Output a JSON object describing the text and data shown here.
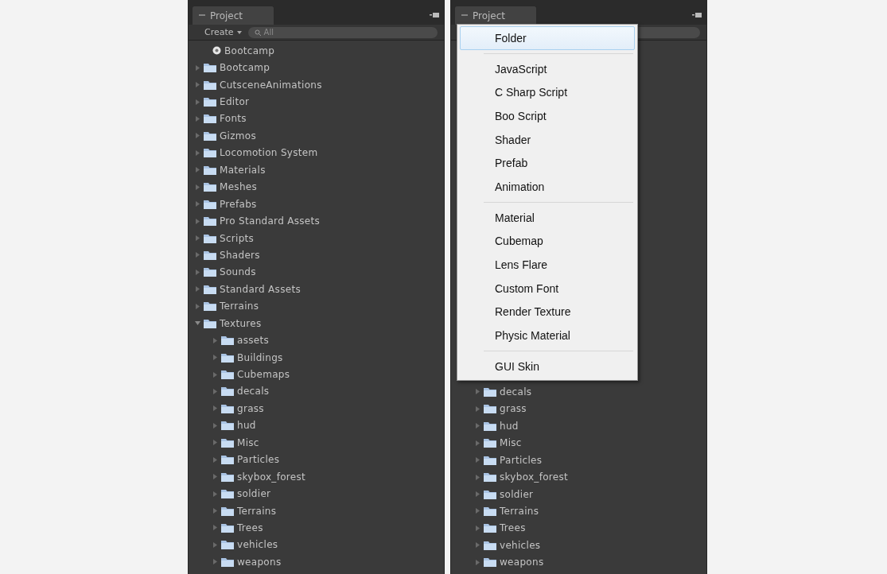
{
  "panels": [
    {
      "tab": {
        "label": "Project"
      },
      "toolbar": {
        "create": "Create",
        "search": {
          "placeholder": "All"
        }
      },
      "tree": [
        {
          "kind": "scene",
          "label": "Bootcamp"
        },
        {
          "kind": "folder",
          "label": "Bootcamp",
          "expanded": false
        },
        {
          "kind": "folder",
          "label": "CutsceneAnimations",
          "expanded": false
        },
        {
          "kind": "folder",
          "label": "Editor",
          "expanded": false
        },
        {
          "kind": "folder",
          "label": "Fonts",
          "expanded": false
        },
        {
          "kind": "folder",
          "label": "Gizmos",
          "expanded": false
        },
        {
          "kind": "folder",
          "label": "Locomotion System",
          "expanded": false
        },
        {
          "kind": "folder",
          "label": "Materials",
          "expanded": false
        },
        {
          "kind": "folder",
          "label": "Meshes",
          "expanded": false
        },
        {
          "kind": "folder",
          "label": "Prefabs",
          "expanded": false
        },
        {
          "kind": "folder",
          "label": "Pro Standard Assets",
          "expanded": false
        },
        {
          "kind": "folder",
          "label": "Scripts",
          "expanded": false
        },
        {
          "kind": "folder",
          "label": "Shaders",
          "expanded": false
        },
        {
          "kind": "folder",
          "label": "Sounds",
          "expanded": false
        },
        {
          "kind": "folder",
          "label": "Standard Assets",
          "expanded": false
        },
        {
          "kind": "folder",
          "label": "Terrains",
          "expanded": false
        },
        {
          "kind": "folder",
          "label": "Textures",
          "expanded": true,
          "children": [
            {
              "kind": "folder",
              "label": "assets",
              "expanded": false
            },
            {
              "kind": "folder",
              "label": "Buildings",
              "expanded": false
            },
            {
              "kind": "folder",
              "label": "Cubemaps",
              "expanded": false
            },
            {
              "kind": "folder",
              "label": "decals",
              "expanded": false
            },
            {
              "kind": "folder",
              "label": "grass",
              "expanded": false
            },
            {
              "kind": "folder",
              "label": "hud",
              "expanded": false
            },
            {
              "kind": "folder",
              "label": "Misc",
              "expanded": false
            },
            {
              "kind": "folder",
              "label": "Particles",
              "expanded": false
            },
            {
              "kind": "folder",
              "label": "skybox_forest",
              "expanded": false
            },
            {
              "kind": "folder",
              "label": "soldier",
              "expanded": false
            },
            {
              "kind": "folder",
              "label": "Terrains",
              "expanded": false
            },
            {
              "kind": "folder",
              "label": "Trees",
              "expanded": false
            },
            {
              "kind": "folder",
              "label": "vehicles",
              "expanded": false
            },
            {
              "kind": "folder",
              "label": "weapons",
              "expanded": false
            }
          ]
        }
      ]
    },
    {
      "tab": {
        "label": "Project"
      },
      "tree": [
        {
          "kind": "folder",
          "label": "decals",
          "expanded": false
        },
        {
          "kind": "folder",
          "label": "grass",
          "expanded": false
        },
        {
          "kind": "folder",
          "label": "hud",
          "expanded": false
        },
        {
          "kind": "folder",
          "label": "Misc",
          "expanded": false
        },
        {
          "kind": "folder",
          "label": "Particles",
          "expanded": false
        },
        {
          "kind": "folder",
          "label": "skybox_forest",
          "expanded": false
        },
        {
          "kind": "folder",
          "label": "soldier",
          "expanded": false
        },
        {
          "kind": "folder",
          "label": "Terrains",
          "expanded": false
        },
        {
          "kind": "folder",
          "label": "Trees",
          "expanded": false
        },
        {
          "kind": "folder",
          "label": "vehicles",
          "expanded": false
        },
        {
          "kind": "folder",
          "label": "weapons",
          "expanded": false
        }
      ],
      "menu": {
        "groups": [
          [
            {
              "label": "Folder",
              "selected": true
            }
          ],
          [
            {
              "label": "JavaScript",
              "selected": false
            },
            {
              "label": "C Sharp Script",
              "selected": false
            },
            {
              "label": "Boo Script",
              "selected": false
            },
            {
              "label": "Shader",
              "selected": false
            },
            {
              "label": "Prefab",
              "selected": false
            },
            {
              "label": "Animation",
              "selected": false
            }
          ],
          [
            {
              "label": "Material",
              "selected": false
            },
            {
              "label": "Cubemap",
              "selected": false
            },
            {
              "label": "Lens Flare",
              "selected": false
            },
            {
              "label": "Custom Font",
              "selected": false
            },
            {
              "label": "Render Texture",
              "selected": false
            },
            {
              "label": "Physic Material",
              "selected": false
            }
          ],
          [
            {
              "label": "GUI Skin",
              "selected": false
            }
          ]
        ]
      }
    }
  ]
}
